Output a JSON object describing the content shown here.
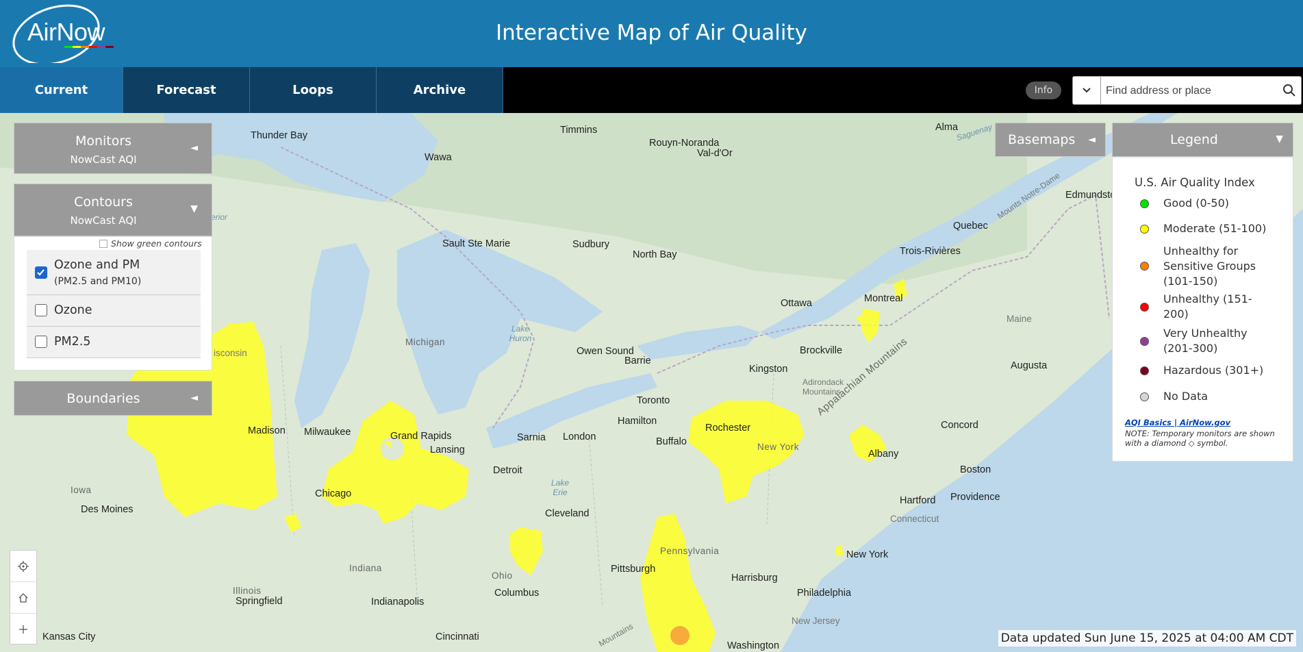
{
  "app": {
    "logo_text": "AirNow",
    "title": "Interactive Map of Air Quality"
  },
  "nav": {
    "tabs": [
      {
        "label": "Current",
        "active": true
      },
      {
        "label": "Forecast",
        "active": false
      },
      {
        "label": "Loops",
        "active": false
      },
      {
        "label": "Archive",
        "active": false
      }
    ],
    "info_label": "Info",
    "search_placeholder": "Find address or place"
  },
  "panels": {
    "monitors": {
      "title": "Monitors",
      "subtitle": "NowCast AQI",
      "arrow": "◄"
    },
    "contours": {
      "title": "Contours",
      "subtitle": "NowCast AQI",
      "arrow": "▼",
      "show_green_label": "Show green contours",
      "show_green_checked": false,
      "options": [
        {
          "label": "Ozone and PM",
          "sublabel": "(PM2.5 and PM10)",
          "checked": true
        },
        {
          "label": "Ozone",
          "sublabel": "",
          "checked": false
        },
        {
          "label": "PM2.5",
          "sublabel": "",
          "checked": false
        }
      ]
    },
    "boundaries": {
      "title": "Boundaries",
      "arrow": "◄"
    },
    "basemaps": {
      "title": "Basemaps",
      "arrow": "◄"
    },
    "legend": {
      "title": "Legend",
      "arrow": "▼",
      "heading": "U.S. Air Quality Index",
      "items": [
        {
          "label": "Good (0-50)",
          "color": "#00e400"
        },
        {
          "label": "Moderate (51-100)",
          "color": "#ffff00"
        },
        {
          "label": "Unhealthy for Sensitive Groups (101-150)",
          "color": "#ff7e00"
        },
        {
          "label": "Unhealthy (151-200)",
          "color": "#ff0000"
        },
        {
          "label": "Very Unhealthy (201-300)",
          "color": "#8f3f97"
        },
        {
          "label": "Hazardous (301+)",
          "color": "#7e0023"
        },
        {
          "label": "No Data",
          "color": "#d6d6d6"
        }
      ],
      "link": "AQI Basics | AirNow.gov",
      "note": "NOTE: Temporary monitors are shown with a diamond ◇ symbol."
    }
  },
  "map": {
    "cities": [
      "Thunder Bay",
      "Timmins",
      "Rouyn-Noranda",
      "Val-d'Or",
      "Alma",
      "Wawa",
      "Quebec",
      "Edmundston",
      "Sault Ste Marie",
      "Sudbury",
      "North Bay",
      "Trois-Rivières",
      "Ottawa",
      "Montreal",
      "Owen Sound",
      "Barrie",
      "Brockville",
      "Kingston",
      "Augusta",
      "Toronto",
      "Madison",
      "Milwaukee",
      "Grand Rapids",
      "Lansing",
      "Sarnia",
      "London",
      "Hamilton",
      "Buffalo",
      "Rochester",
      "Albany",
      "Concord",
      "Des Moines",
      "Chicago",
      "Detroit",
      "Boston",
      "Hartford",
      "Providence",
      "Cleveland",
      "New York",
      "Pittsburgh",
      "Harrisburg",
      "Columbus",
      "Philadelphia",
      "Springfield",
      "Indianapolis",
      "Kansas City",
      "Cincinnati",
      "Washington"
    ],
    "regions": [
      "Michigan",
      "New York",
      "Pennsylvania",
      "Indiana",
      "Ohio",
      "Illinois",
      "Iowa",
      "Connecticut",
      "New Jersey",
      "Maine",
      "isconsin",
      "Appalachian Mountains",
      "Adirondack Mountains",
      "Mounts Notre-Dame",
      "Mountains"
    ],
    "water": [
      "Lake Huron",
      "Lake Erie",
      "Saguenay",
      "erior"
    ]
  },
  "controls": [
    "locate-icon",
    "home-icon",
    "zoom-in-icon"
  ],
  "status": {
    "updated": "Data updated Sun June 15, 2025 at 04:00 AM CDT"
  }
}
